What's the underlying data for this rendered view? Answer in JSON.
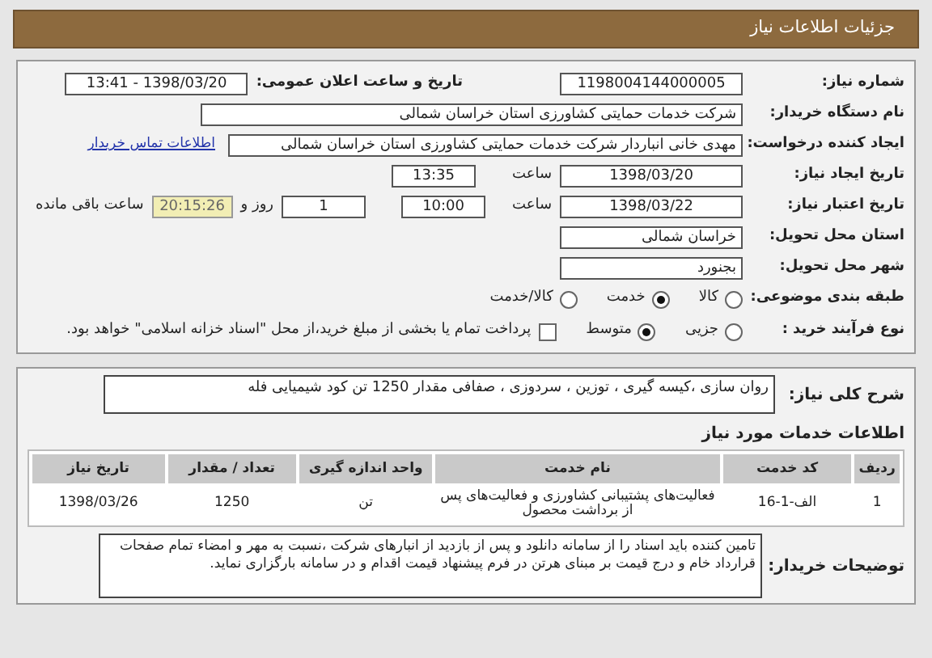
{
  "header": {
    "title": "جزئیات اطلاعات نیاز"
  },
  "need_number": {
    "label": "شماره نیاز:",
    "value": "1198004144000005"
  },
  "announce": {
    "label": "تاریخ و ساعت اعلان عمومی:",
    "value": "1398/03/20 - 13:41"
  },
  "buyer_org": {
    "label": "نام دستگاه خریدار:",
    "value": "شرکت خدمات حمایتی کشاورزی استان خراسان شمالی"
  },
  "requester": {
    "label": "ایجاد کننده درخواست:",
    "value": "مهدی خانی انباردار شرکت خدمات حمایتی کشاورزی استان خراسان شمالی",
    "link": "اطلاعات تماس خریدار"
  },
  "created": {
    "label": "تاریخ ایجاد نیاز:",
    "date": "1398/03/20",
    "time_label": "ساعت",
    "time": "13:35"
  },
  "deadline": {
    "label": "تاریخ اعتبار نیاز:",
    "date": "1398/03/22",
    "time_label": "ساعت",
    "time": "10:00",
    "days": "1",
    "days_label": "روز و",
    "remaining": "20:15:26",
    "remaining_label": "ساعت باقی مانده"
  },
  "province": {
    "label": "استان محل تحویل:",
    "value": "خراسان شمالی"
  },
  "city": {
    "label": "شهر محل تحویل:",
    "value": "بجنورد"
  },
  "category": {
    "label": "طبقه بندی موضوعی:",
    "options": [
      {
        "label": "کالا",
        "selected": false
      },
      {
        "label": "خدمت",
        "selected": true
      },
      {
        "label": "کالا/خدمت",
        "selected": false
      }
    ]
  },
  "process": {
    "label": "نوع فرآیند خرید :",
    "options": [
      {
        "label": "جزیی",
        "selected": false
      },
      {
        "label": "متوسط",
        "selected": true
      }
    ],
    "payment": {
      "label": "پرداخت تمام یا بخشی از مبلغ خرید،از محل \"اسناد خزانه اسلامی\" خواهد بود.",
      "checked": false
    }
  },
  "description": {
    "label": "شرح کلی نیاز:",
    "value": "روان سازی ،کیسه گیری ، توزین ، سردوزی ، صفافی مقدار 1250 تن کود شیمیایی فله"
  },
  "services": {
    "title": "اطلاعات خدمات مورد نیاز",
    "columns": [
      "ردیف",
      "کد خدمت",
      "نام خدمت",
      "واحد اندازه گیری",
      "تعداد / مقدار",
      "تاریخ نیاز"
    ],
    "rows": [
      [
        "1",
        "الف-1-16",
        "فعالیت‌های پشتیبانی کشاورزی و فعالیت‌های پس از برداشت محصول",
        "تن",
        "1250",
        "1398/03/26"
      ]
    ]
  },
  "buyer_notes": {
    "label": "توضیحات خریدار:",
    "value": "تامین کننده باید اسناد را از سامانه دانلود و پس از بازدید از انبارهای شرکت ،نسبت به مهر و امضاء تمام صفحات قرارداد خام و درج قیمت بر مبنای هرتن در فرم پیشنهاد قیمت اقدام و در سامانه بارگزاری نماید."
  }
}
